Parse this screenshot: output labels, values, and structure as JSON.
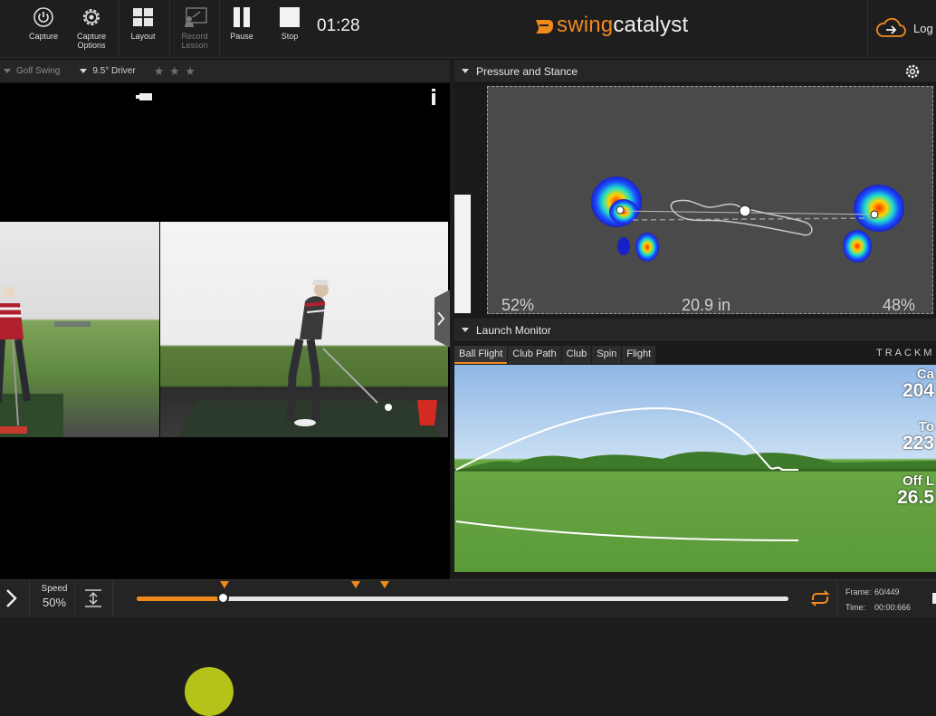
{
  "toolbar": {
    "capture": "Capture",
    "capture_options": "Capture\nOptions",
    "layout": "Layout",
    "record_lesson": "Record\nLesson",
    "pause": "Pause",
    "stop": "Stop",
    "timer": "01:28",
    "login": "Log"
  },
  "logo": {
    "swing": "swing",
    "catalyst": "catalyst"
  },
  "video_panel": {
    "category": "Golf Swing",
    "club": "9.5° Driver",
    "stars": "★ ★ ★"
  },
  "pressure_panel": {
    "title": "Pressure and Stance",
    "left_pct": "52%",
    "distance": "20.9 in",
    "right_pct": "48%"
  },
  "launch_panel": {
    "title": "Launch Monitor",
    "tabs": [
      "Ball Flight",
      "Club Path",
      "Club",
      "Spin",
      "Flight"
    ],
    "brand": "TRACKM",
    "metrics": [
      {
        "label": "Ca",
        "value": "204"
      },
      {
        "label": "To",
        "value": "223"
      },
      {
        "label": "Off L",
        "value": "26.5"
      }
    ]
  },
  "transport": {
    "speed_label": "Speed",
    "speed_value": "50%",
    "progress": 0.134,
    "frame_label": "Frame:",
    "frame_value": "60/449",
    "time_label": "Time:",
    "time_value": "00:00:666"
  },
  "colors": {
    "accent": "#f08a1c",
    "play_button": "#b5c21a"
  }
}
